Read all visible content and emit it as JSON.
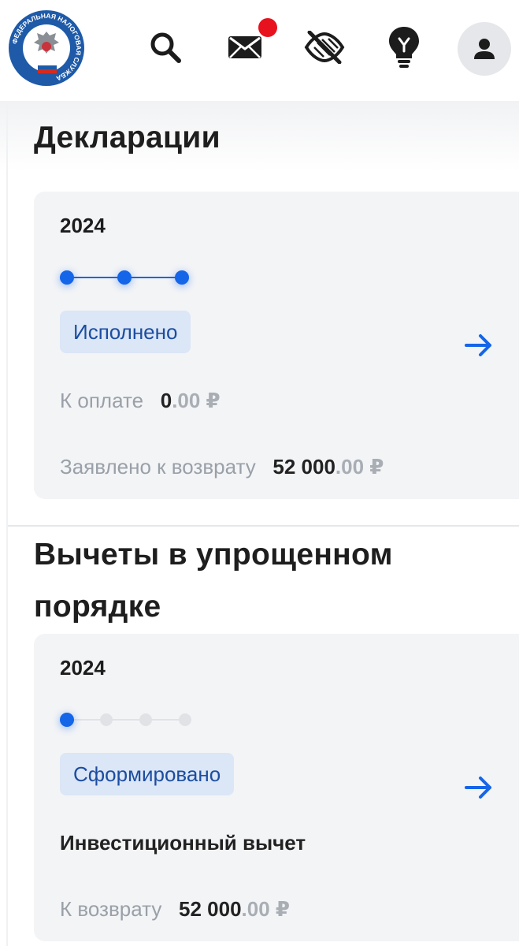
{
  "header": {
    "logo_text": "ФЕДЕРАЛЬНАЯ НАЛОГОВАЯ СЛУЖБА",
    "icons": [
      "search-icon",
      "mail-icon",
      "hide-eye-icon",
      "lightbulb-icon",
      "user-icon"
    ],
    "mail_has_notification": true
  },
  "declarations": {
    "title": "Декларации",
    "card": {
      "year": "2024",
      "steps_total": 3,
      "steps_done": 3,
      "status": "Исполнено",
      "to_pay_label": "К оплате",
      "to_pay_int": "0",
      "to_pay_frac": ".00 ₽",
      "refund_label": "Заявлено к возврату",
      "refund_int": "52 000",
      "refund_frac": ".00 ₽"
    }
  },
  "deductions": {
    "title_line1": "Вычеты в упрощенном",
    "title_line2": "порядке",
    "card": {
      "year": "2024",
      "steps_total": 4,
      "steps_done": 1,
      "status": "Сформировано",
      "type": "Инвестиционный вычет",
      "refund_label": "К возврату",
      "refund_int": "52 000",
      "refund_frac": ".00 ₽"
    }
  },
  "colors": {
    "accent": "#1565e8",
    "status_bg": "#dbe6f6",
    "status_text": "#1c4da0",
    "card_bg": "#f3f4f6",
    "badge": "#e8121f"
  }
}
